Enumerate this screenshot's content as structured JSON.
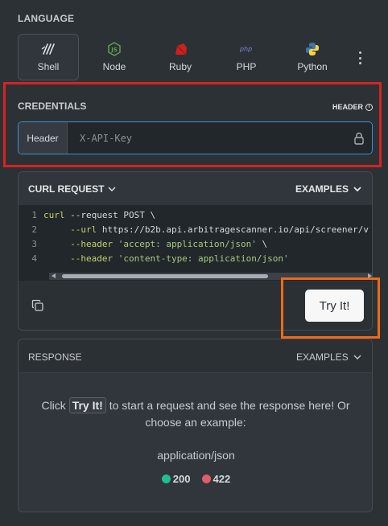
{
  "language": {
    "title": "LANGUAGE",
    "items": [
      {
        "label": "Shell",
        "icon": "shell-icon",
        "active": true
      },
      {
        "label": "Node",
        "icon": "node-icon"
      },
      {
        "label": "Ruby",
        "icon": "ruby-icon"
      },
      {
        "label": "PHP",
        "icon": "php-icon"
      },
      {
        "label": "Python",
        "icon": "python-icon"
      }
    ],
    "more_icon": "more-vertical-icon"
  },
  "credentials": {
    "title": "CREDENTIALS",
    "header_label": "HEADER",
    "prefix": "Header",
    "placeholder": "X-API-Key",
    "value": ""
  },
  "curl": {
    "title": "CURL REQUEST",
    "examples_label": "EXAMPLES",
    "lines": [
      {
        "num": "1",
        "cmd": "curl",
        "rest": " --request POST \\"
      },
      {
        "num": "2",
        "cmd": "     --url",
        "rest": " https://b2b.api.arbitragescanner.io/api/screener/v"
      },
      {
        "num": "3",
        "cmd": "     --header",
        "str": " 'accept: application/json'",
        "rest": " \\"
      },
      {
        "num": "4",
        "cmd": "     --header",
        "str": " 'content-type: application/json'",
        "rest": ""
      }
    ],
    "try_label": "Try It!"
  },
  "response": {
    "title": "RESPONSE",
    "examples_label": "EXAMPLES",
    "text_before": "Click",
    "try_chip": "Try It!",
    "text_after": "to start a request and see the response here! Or choose an example:",
    "mime": "application/json",
    "statuses": [
      {
        "code": "200",
        "color": "#1fbf8f"
      },
      {
        "code": "422",
        "color": "#e25c6a"
      }
    ]
  },
  "colors": {
    "background": "#2c3136",
    "highlight_red": "#d8231f",
    "highlight_orange": "#f06a14",
    "input_focus": "#3d8fd6"
  }
}
